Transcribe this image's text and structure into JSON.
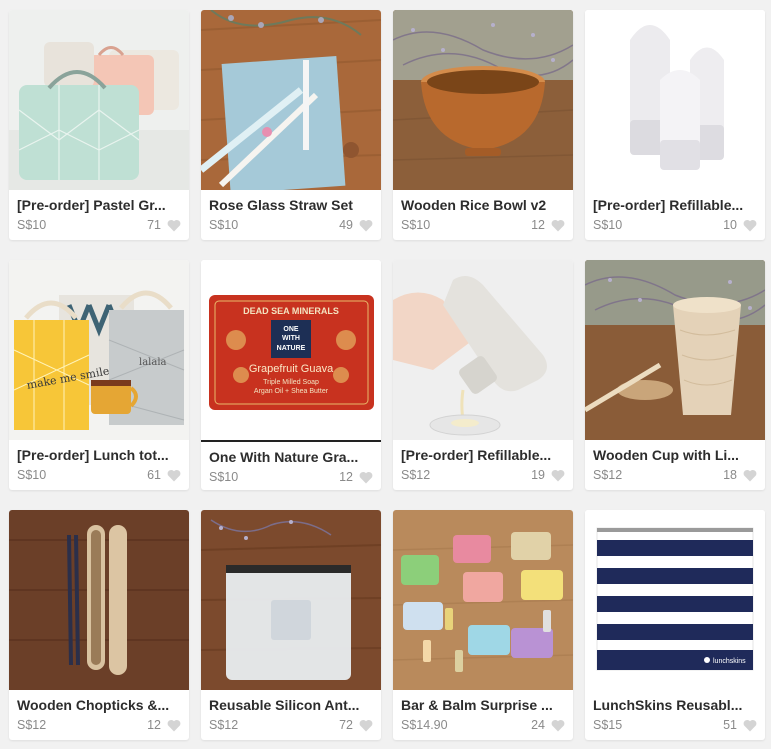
{
  "colors": {
    "background": "#f1f1f1",
    "card": "#ffffff",
    "title": "#2d2d2d",
    "meta": "#8a8a8a",
    "heart": "#d4d4d4"
  },
  "products": [
    {
      "title": "[Pre-order] Pastel Gr...",
      "price": "S$10",
      "likes": "71",
      "image": "pastel-lunch-bags-photo"
    },
    {
      "title": "Rose Glass Straw Set",
      "price": "S$10",
      "likes": "49",
      "image": "glass-straw-photo"
    },
    {
      "title": "Wooden Rice Bowl v2",
      "price": "S$10",
      "likes": "12",
      "image": "wooden-bowl-photo"
    },
    {
      "title": "[Pre-order] Refillable...",
      "price": "S$10",
      "likes": "10",
      "image": "silicone-bottles-photo"
    },
    {
      "title": "[Pre-order] Lunch tot...",
      "price": "S$10",
      "likes": "61",
      "image": "lunch-totes-photo"
    },
    {
      "title": "One With Nature Gra...",
      "price": "S$10",
      "likes": "12",
      "image": "soap-bar-photo"
    },
    {
      "title": "[Pre-order] Refillable...",
      "price": "S$12",
      "likes": "19",
      "image": "squeeze-bottle-photo"
    },
    {
      "title": "Wooden Cup with Li...",
      "price": "S$12",
      "likes": "18",
      "image": "wooden-cup-photo"
    },
    {
      "title": "Wooden Chopticks &...",
      "price": "S$12",
      "likes": "12",
      "image": "chopsticks-photo"
    },
    {
      "title": "Reusable Silicon Ant...",
      "price": "S$12",
      "likes": "72",
      "image": "silicone-bag-photo"
    },
    {
      "title": "Bar & Balm Surprise ...",
      "price": "S$14.90",
      "likes": "24",
      "image": "soap-assortment-photo"
    },
    {
      "title": "LunchSkins Reusabl...",
      "price": "S$15",
      "likes": "51",
      "image": "striped-pouch-photo"
    }
  ],
  "soap": {
    "brand_top": "DEAD SEA MINERALS",
    "logo_line1": "ONE",
    "logo_line2": "WITH",
    "logo_line3": "NATURE",
    "flavor": "Grapefruit Guava",
    "line1": "Triple Milled Soap",
    "line2": "Argan Oil + Shea Butter"
  },
  "pouch_brand": "lunchskins",
  "tote_text": "make me smile"
}
